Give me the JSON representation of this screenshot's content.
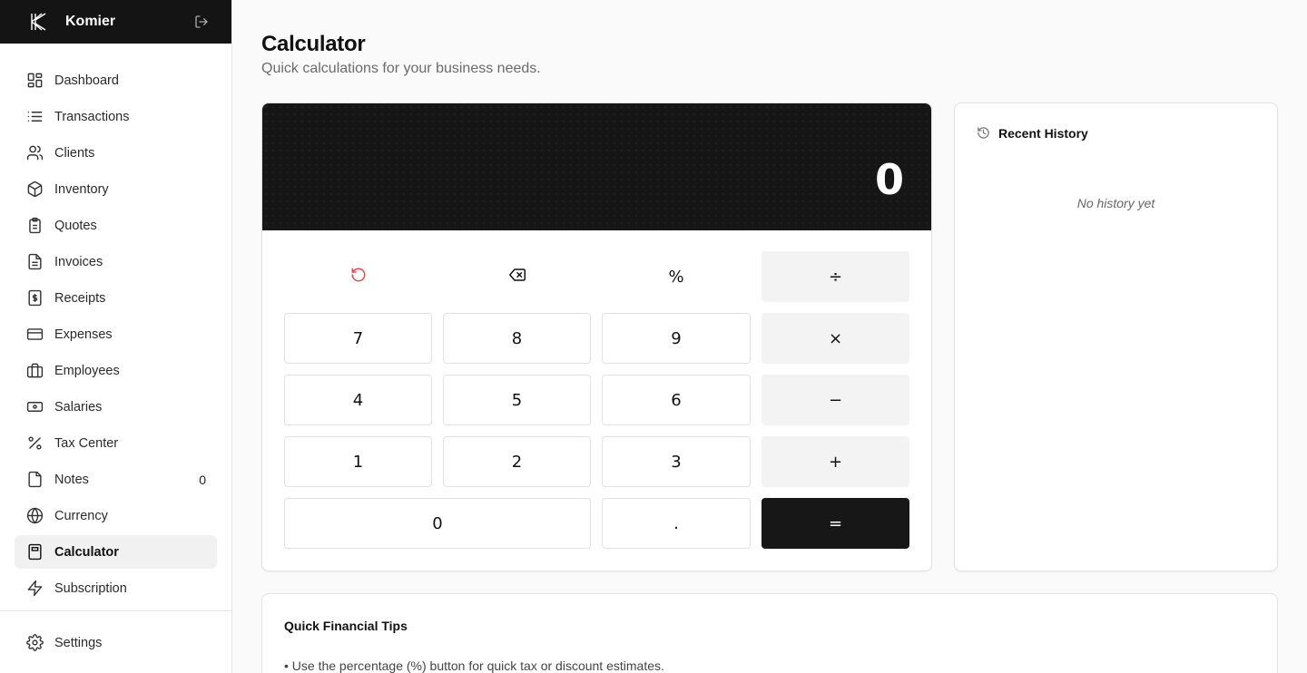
{
  "brand": {
    "name": "Komier",
    "logo_icon": "komier-logo-icon",
    "exit_icon": "logout-icon"
  },
  "sidebar": {
    "items": [
      {
        "label": "Dashboard",
        "icon": "dashboard-grid-icon"
      },
      {
        "label": "Transactions",
        "icon": "list-icon"
      },
      {
        "label": "Clients",
        "icon": "users-icon"
      },
      {
        "label": "Inventory",
        "icon": "package-icon"
      },
      {
        "label": "Quotes",
        "icon": "clipboard-icon"
      },
      {
        "label": "Invoices",
        "icon": "file-text-icon"
      },
      {
        "label": "Receipts",
        "icon": "receipt-dollar-icon"
      },
      {
        "label": "Expenses",
        "icon": "credit-card-icon"
      },
      {
        "label": "Employees",
        "icon": "briefcase-icon"
      },
      {
        "label": "Salaries",
        "icon": "banknote-icon"
      },
      {
        "label": "Tax Center",
        "icon": "percent-icon"
      },
      {
        "label": "Notes",
        "icon": "sticky-note-icon",
        "count": "0"
      },
      {
        "label": "Currency",
        "icon": "globe-icon"
      },
      {
        "label": "Calculator",
        "icon": "calculator-icon",
        "active": true
      },
      {
        "label": "Subscription",
        "icon": "zap-icon"
      }
    ],
    "bottom": {
      "label": "Settings",
      "icon": "gear-icon"
    }
  },
  "page": {
    "title": "Calculator",
    "subtitle": "Quick calculations for your business needs."
  },
  "calculator": {
    "display": "0",
    "keys": {
      "reset_icon": "reset-icon",
      "backspace_icon": "backspace-icon",
      "percent": "%",
      "divide": "÷",
      "multiply": "×",
      "subtract": "−",
      "add": "+",
      "equals": "=",
      "seven": "7",
      "eight": "8",
      "nine": "9",
      "four": "4",
      "five": "5",
      "six": "6",
      "one": "1",
      "two": "2",
      "three": "3",
      "zero": "0",
      "dot": "."
    },
    "colors": {
      "display_bg": "#161616",
      "reset": "#e5484d",
      "equals_bg": "#171717"
    }
  },
  "history": {
    "title": "Recent History",
    "icon": "history-icon",
    "empty": "No history yet"
  },
  "tips": {
    "title": "Quick Financial Tips",
    "items": [
      "• Use the percentage (%) button for quick tax or discount estimates."
    ]
  }
}
